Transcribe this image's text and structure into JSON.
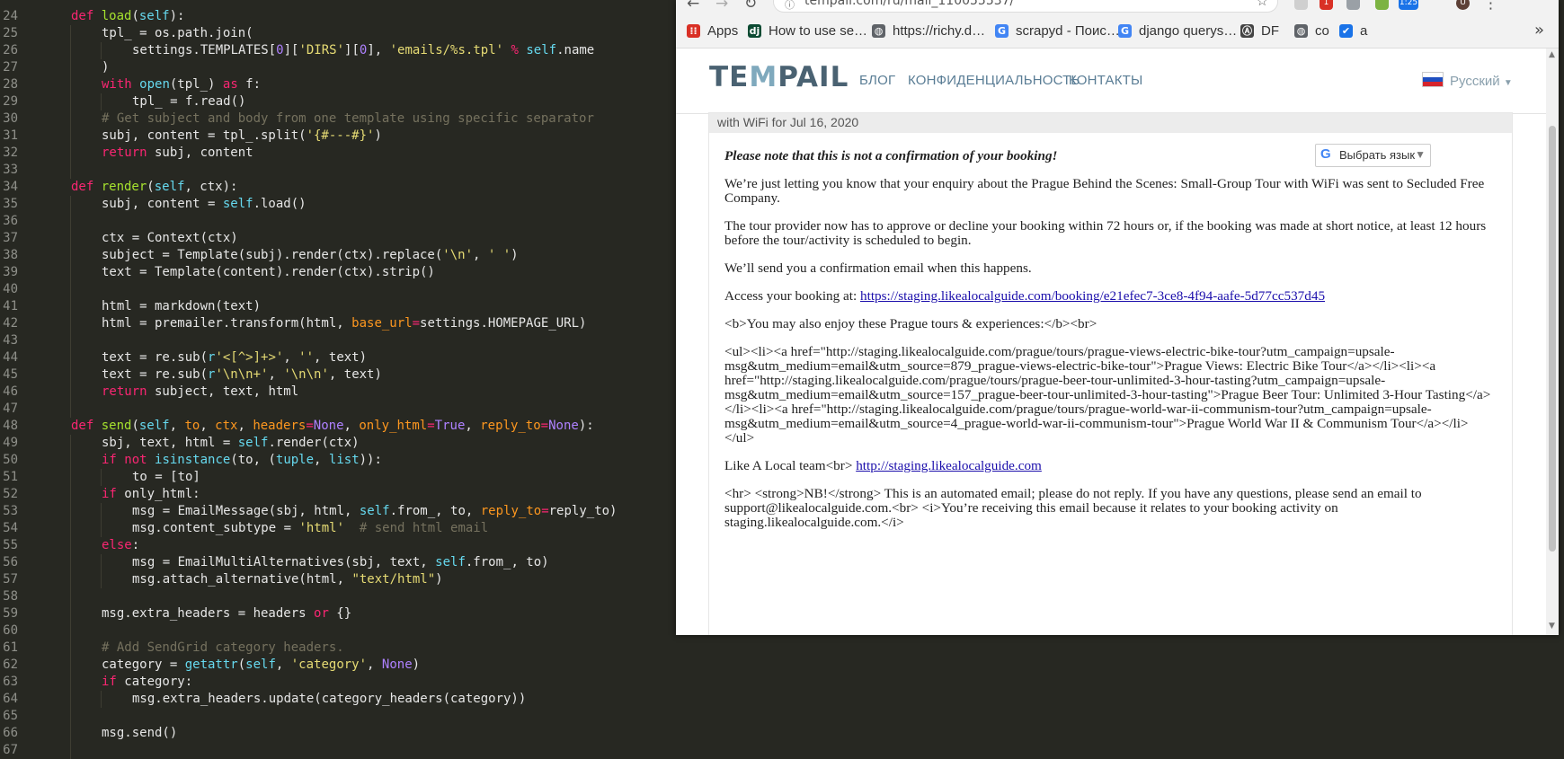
{
  "editor": {
    "lines": [
      {
        "num": "24",
        "guides": 0,
        "indent": 0,
        "tokens": [
          [
            "kw",
            "def "
          ],
          [
            "fn",
            "load"
          ],
          [
            "pl",
            "("
          ],
          [
            "sf",
            "self"
          ],
          [
            "pl",
            "):"
          ]
        ]
      },
      {
        "num": "25",
        "guides": 1,
        "indent": 1,
        "tokens": [
          [
            "pl",
            "tpl_ = os.path.join("
          ]
        ]
      },
      {
        "num": "26",
        "guides": 2,
        "indent": 2,
        "tokens": [
          [
            "pl",
            "settings.TEMPLATES["
          ],
          [
            "nm",
            "0"
          ],
          [
            "pl",
            "]["
          ],
          [
            "str",
            "'DIRS'"
          ],
          [
            "pl",
            "]["
          ],
          [
            "nm",
            "0"
          ],
          [
            "pl",
            "], "
          ],
          [
            "str",
            "'emails/%s.tpl'"
          ],
          [
            "pl",
            " "
          ],
          [
            "kw",
            "%"
          ],
          [
            "pl",
            " "
          ],
          [
            "sf",
            "self"
          ],
          [
            "pl",
            ".name"
          ]
        ]
      },
      {
        "num": "27",
        "guides": 1,
        "indent": 1,
        "tokens": [
          [
            "pl",
            ")"
          ]
        ]
      },
      {
        "num": "28",
        "guides": 1,
        "indent": 1,
        "tokens": [
          [
            "kw",
            "with "
          ],
          [
            "bi",
            "open"
          ],
          [
            "pl",
            "(tpl_) "
          ],
          [
            "kw",
            "as"
          ],
          [
            "pl",
            " f:"
          ]
        ]
      },
      {
        "num": "29",
        "guides": 2,
        "indent": 2,
        "tokens": [
          [
            "pl",
            "tpl_ = f.read()"
          ]
        ]
      },
      {
        "num": "30",
        "guides": 1,
        "indent": 1,
        "tokens": [
          [
            "cm",
            "# Get subject and body from one template using specific separator"
          ]
        ]
      },
      {
        "num": "31",
        "guides": 1,
        "indent": 1,
        "tokens": [
          [
            "pl",
            "subj, content = tpl_.split("
          ],
          [
            "str",
            "'{#---#}'"
          ],
          [
            "pl",
            ")"
          ]
        ]
      },
      {
        "num": "32",
        "guides": 1,
        "indent": 1,
        "tokens": [
          [
            "kw",
            "return"
          ],
          [
            "pl",
            " subj, content"
          ]
        ]
      },
      {
        "num": "33",
        "guides": 1,
        "indent": 0,
        "tokens": []
      },
      {
        "num": "34",
        "guides": 0,
        "indent": 0,
        "tokens": [
          [
            "kw",
            "def "
          ],
          [
            "fn",
            "render"
          ],
          [
            "pl",
            "("
          ],
          [
            "sf",
            "self"
          ],
          [
            "pl",
            ", ctx):"
          ]
        ]
      },
      {
        "num": "35",
        "guides": 1,
        "indent": 1,
        "tokens": [
          [
            "pl",
            "subj, content = "
          ],
          [
            "sf",
            "self"
          ],
          [
            "pl",
            ".load()"
          ]
        ]
      },
      {
        "num": "36",
        "guides": 1,
        "indent": 0,
        "tokens": []
      },
      {
        "num": "37",
        "guides": 1,
        "indent": 1,
        "tokens": [
          [
            "pl",
            "ctx = Context(ctx)"
          ]
        ]
      },
      {
        "num": "38",
        "guides": 1,
        "indent": 1,
        "tokens": [
          [
            "pl",
            "subject = Template(subj).render(ctx).replace("
          ],
          [
            "str",
            "'\\n'"
          ],
          [
            "pl",
            ", "
          ],
          [
            "str",
            "' '"
          ],
          [
            "pl",
            ")"
          ]
        ]
      },
      {
        "num": "39",
        "guides": 1,
        "indent": 1,
        "tokens": [
          [
            "pl",
            "text = Template(content).render(ctx).strip()"
          ]
        ]
      },
      {
        "num": "40",
        "guides": 1,
        "indent": 0,
        "tokens": []
      },
      {
        "num": "41",
        "guides": 1,
        "indent": 1,
        "tokens": [
          [
            "pl",
            "html = markdown(text)"
          ]
        ]
      },
      {
        "num": "42",
        "guides": 1,
        "indent": 1,
        "tokens": [
          [
            "pl",
            "html = premailer.transform(html, "
          ],
          [
            "pm",
            "base_url"
          ],
          [
            "kw",
            "="
          ],
          [
            "pl",
            "settings.HOMEPAGE_URL)"
          ]
        ]
      },
      {
        "num": "43",
        "guides": 1,
        "indent": 0,
        "tokens": []
      },
      {
        "num": "44",
        "guides": 1,
        "indent": 1,
        "tokens": [
          [
            "pl",
            "text = re.sub("
          ],
          [
            "df",
            "r"
          ],
          [
            "str",
            "'<[^>]+>'"
          ],
          [
            "pl",
            ", "
          ],
          [
            "str",
            "''"
          ],
          [
            "pl",
            ", text)"
          ]
        ]
      },
      {
        "num": "45",
        "guides": 1,
        "indent": 1,
        "tokens": [
          [
            "pl",
            "text = re.sub("
          ],
          [
            "df",
            "r"
          ],
          [
            "str",
            "'\\n\\n+'"
          ],
          [
            "pl",
            ", "
          ],
          [
            "str",
            "'\\n\\n'"
          ],
          [
            "pl",
            ", text)"
          ]
        ]
      },
      {
        "num": "46",
        "guides": 1,
        "indent": 1,
        "tokens": [
          [
            "kw",
            "return"
          ],
          [
            "pl",
            " subject, text, html"
          ]
        ]
      },
      {
        "num": "47",
        "guides": 1,
        "indent": 0,
        "tokens": []
      },
      {
        "num": "48",
        "guides": 0,
        "indent": 0,
        "tokens": [
          [
            "kw",
            "def "
          ],
          [
            "fn",
            "send"
          ],
          [
            "pl",
            "("
          ],
          [
            "sf",
            "self"
          ],
          [
            "pl",
            ", "
          ],
          [
            "pm",
            "to"
          ],
          [
            "pl",
            ", "
          ],
          [
            "pm",
            "ctx"
          ],
          [
            "pl",
            ", "
          ],
          [
            "pm",
            "headers"
          ],
          [
            "kw",
            "="
          ],
          [
            "nm",
            "None"
          ],
          [
            "pl",
            ", "
          ],
          [
            "pm",
            "only_html"
          ],
          [
            "kw",
            "="
          ],
          [
            "nm",
            "True"
          ],
          [
            "pl",
            ", "
          ],
          [
            "pm",
            "reply_to"
          ],
          [
            "kw",
            "="
          ],
          [
            "nm",
            "None"
          ],
          [
            "pl",
            "):"
          ]
        ]
      },
      {
        "num": "49",
        "guides": 1,
        "indent": 1,
        "tokens": [
          [
            "pl",
            "sbj, text, html = "
          ],
          [
            "sf",
            "self"
          ],
          [
            "pl",
            ".render(ctx)"
          ]
        ]
      },
      {
        "num": "50",
        "guides": 1,
        "indent": 1,
        "tokens": [
          [
            "kw",
            "if not "
          ],
          [
            "bi",
            "isinstance"
          ],
          [
            "pl",
            "(to, ("
          ],
          [
            "bi",
            "tuple"
          ],
          [
            "pl",
            ", "
          ],
          [
            "bi",
            "list"
          ],
          [
            "pl",
            ")):"
          ]
        ]
      },
      {
        "num": "51",
        "guides": 2,
        "indent": 2,
        "tokens": [
          [
            "pl",
            "to = [to]"
          ]
        ]
      },
      {
        "num": "52",
        "guides": 1,
        "indent": 1,
        "tokens": [
          [
            "kw",
            "if"
          ],
          [
            "pl",
            " only_html:"
          ]
        ]
      },
      {
        "num": "53",
        "guides": 2,
        "indent": 2,
        "tokens": [
          [
            "pl",
            "msg = EmailMessage(sbj, html, "
          ],
          [
            "sf",
            "self"
          ],
          [
            "pl",
            ".from_, to, "
          ],
          [
            "pm",
            "reply_to"
          ],
          [
            "kw",
            "="
          ],
          [
            "pl",
            "reply_to)"
          ]
        ]
      },
      {
        "num": "54",
        "guides": 2,
        "indent": 2,
        "tokens": [
          [
            "pl",
            "msg.content_subtype = "
          ],
          [
            "str",
            "'html'"
          ],
          [
            "pl",
            "  "
          ],
          [
            "cm",
            "# send html email"
          ]
        ]
      },
      {
        "num": "55",
        "guides": 1,
        "indent": 1,
        "tokens": [
          [
            "kw",
            "else"
          ],
          [
            "pl",
            ":"
          ]
        ]
      },
      {
        "num": "56",
        "guides": 2,
        "indent": 2,
        "tokens": [
          [
            "pl",
            "msg = EmailMultiAlternatives(sbj, text, "
          ],
          [
            "sf",
            "self"
          ],
          [
            "pl",
            ".from_, to)"
          ]
        ]
      },
      {
        "num": "57",
        "guides": 2,
        "indent": 2,
        "tokens": [
          [
            "pl",
            "msg.attach_alternative(html, "
          ],
          [
            "str",
            "\"text/html\""
          ],
          [
            "pl",
            ")"
          ]
        ]
      },
      {
        "num": "58",
        "guides": 1,
        "indent": 0,
        "tokens": []
      },
      {
        "num": "59",
        "guides": 1,
        "indent": 1,
        "tokens": [
          [
            "pl",
            "msg.extra_headers = headers "
          ],
          [
            "kw",
            "or"
          ],
          [
            "pl",
            " {}"
          ]
        ]
      },
      {
        "num": "60",
        "guides": 1,
        "indent": 0,
        "tokens": []
      },
      {
        "num": "61",
        "guides": 1,
        "indent": 1,
        "tokens": [
          [
            "cm",
            "# Add SendGrid category headers."
          ]
        ]
      },
      {
        "num": "62",
        "guides": 1,
        "indent": 1,
        "tokens": [
          [
            "pl",
            "category = "
          ],
          [
            "bi",
            "getattr"
          ],
          [
            "pl",
            "("
          ],
          [
            "sf",
            "self"
          ],
          [
            "pl",
            ", "
          ],
          [
            "str",
            "'category'"
          ],
          [
            "pl",
            ", "
          ],
          [
            "nm",
            "None"
          ],
          [
            "pl",
            ")"
          ]
        ]
      },
      {
        "num": "63",
        "guides": 1,
        "indent": 1,
        "tokens": [
          [
            "kw",
            "if"
          ],
          [
            "pl",
            " category:"
          ]
        ]
      },
      {
        "num": "64",
        "guides": 2,
        "indent": 2,
        "tokens": [
          [
            "pl",
            "msg.extra_headers.update(category_headers(category))"
          ]
        ]
      },
      {
        "num": "65",
        "guides": 1,
        "indent": 0,
        "tokens": []
      },
      {
        "num": "66",
        "guides": 1,
        "indent": 1,
        "tokens": [
          [
            "pl",
            "msg.send()"
          ]
        ]
      },
      {
        "num": "67",
        "guides": 1,
        "indent": 0,
        "tokens": []
      }
    ]
  },
  "browser": {
    "url": "tempail.com/ru/mail_110055537/",
    "ext_badge_1": "1",
    "ext_badge_2": "1:25",
    "profile_initial": "U",
    "bookmarks": [
      {
        "label": "Apps",
        "icon": "apps-grid-icon",
        "color": "#d93025",
        "glyph": "⁞⁞"
      },
      {
        "label": "How to use se…",
        "icon": "django-icon",
        "color": "#0c4b33",
        "glyph": "dj"
      },
      {
        "label": "https://richy.d…",
        "icon": "globe-icon",
        "color": "#5f6368",
        "glyph": "◍"
      },
      {
        "label": "scrapyd - Поис…",
        "icon": "google-icon",
        "color": "#4285f4",
        "glyph": "G"
      },
      {
        "label": "django querys…",
        "icon": "google-icon",
        "color": "#4285f4",
        "glyph": "G"
      },
      {
        "label": "DF",
        "icon": "df-icon",
        "color": "#444444",
        "glyph": "Ⓐ"
      },
      {
        "label": "co",
        "icon": "globe-icon",
        "color": "#5f6368",
        "glyph": "◍"
      },
      {
        "label": "a",
        "icon": "checkbox-icon",
        "color": "#1a73e8",
        "glyph": "✔"
      }
    ],
    "more_bookmarks": "»"
  },
  "site": {
    "logo_parts": [
      "TE",
      "M",
      "PAIL"
    ],
    "nav": [
      "БЛОГ",
      "КОНФИДЕНЦИАЛЬНОСТЬ",
      "КОНТАКТЫ"
    ],
    "language": "Русский"
  },
  "mail": {
    "subject_tail": "with WiFi for Jul 16, 2020",
    "translate_label": "Выбрать язык",
    "note": "Please note that this is not a confirmation of your booking!",
    "p1": "We’re just letting you know that your enquiry about the Prague Behind the Scenes: Small-Group Tour with WiFi was sent to Secluded Free Company.",
    "p2": "The tour provider now has to approve or decline your booking within 72 hours or, if the booking was made at short notice, at least 12 hours before the tour/activity is scheduled to begin.",
    "p3": "We’ll send you a confirmation email when this happens.",
    "access_label": "Access your booking at: ",
    "access_link": "https://staging.likealocalguide.com/booking/e21efec7-3ce8-4f94-aafe-5d77cc537d45",
    "raw_heading": "<b>You may also enjoy these Prague tours & experiences:</b><br>",
    "raw_list": "<ul><li><a href=\"http://staging.likealocalguide.com/prague/tours/prague-views-electric-bike-tour?utm_campaign=upsale-msg&utm_medium=email&utm_source=879_prague-views-electric-bike-tour\">Prague Views: Electric Bike Tour</a></li><li><a href=\"http://staging.likealocalguide.com/prague/tours/prague-beer-tour-unlimited-3-hour-tasting?utm_campaign=upsale-msg&utm_medium=email&utm_source=157_prague-beer-tour-unlimited-3-hour-tasting\">Prague Beer Tour: Unlimited 3-Hour Tasting</a></li><li><a href=\"http://staging.likealocalguide.com/prague/tours/prague-world-war-ii-communism-tour?utm_campaign=upsale-msg&utm_medium=email&utm_source=4_prague-world-war-ii-communism-tour\">Prague World War II & Communism Tour</a></li></ul>",
    "signoff": "Like A Local team<br> ",
    "signoff_link": "http://staging.likealocalguide.com",
    "footer": "<hr> <strong>NB!</strong> This is an automated email; please do not reply. If you have any questions, please send an email to support@likealocalguide.com.<br> <i>You’re receiving this email because it relates to your booking activity on staging.likealocalguide.com.</i>"
  }
}
